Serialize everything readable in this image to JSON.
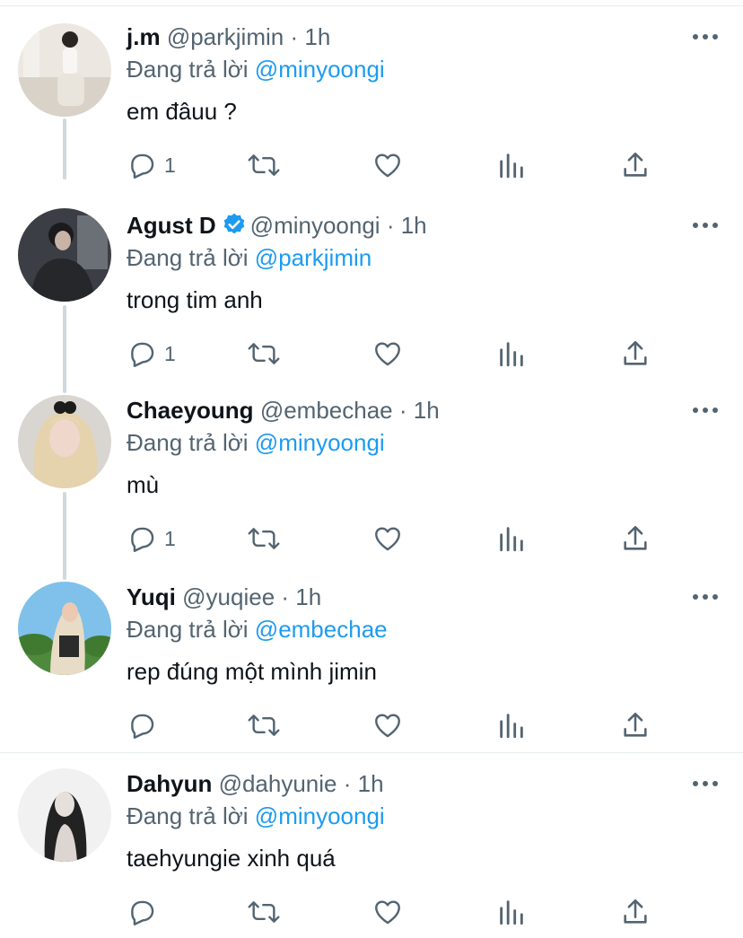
{
  "colors": {
    "accent": "#1d9bf0",
    "muted": "#536471",
    "text": "#0f1419",
    "divider": "#e6ecf0",
    "thread_line": "#cfd9de"
  },
  "reply_prefix": "Đang trả lời",
  "tweets": [
    {
      "name": "j.m",
      "handle": "@parkjimin",
      "time": "1h",
      "reply_to": "@minyoongi",
      "text": "em đâuu ?",
      "reply_count": "1",
      "verified": false
    },
    {
      "name": "Agust D",
      "handle": "@minyoongi",
      "time": "1h",
      "reply_to": "@parkjimin",
      "text": "trong tim anh",
      "reply_count": "1",
      "verified": true
    },
    {
      "name": "Chaeyoung",
      "handle": "@embechae",
      "time": "1h",
      "reply_to": "@minyoongi",
      "text": "mù",
      "reply_count": "1",
      "verified": false
    },
    {
      "name": "Yuqi",
      "handle": "@yuqiee",
      "time": "1h",
      "reply_to": "@embechae",
      "text": "rep đúng một mình jimin",
      "reply_count": "",
      "verified": false
    },
    {
      "name": "Dahyun",
      "handle": "@dahyunie",
      "time": "1h",
      "reply_to": "@minyoongi",
      "text": "taehyungie xinh quá",
      "reply_count": "",
      "verified": false
    }
  ],
  "icons": [
    "reply-icon",
    "retweet-icon",
    "like-icon",
    "analytics-icon",
    "share-icon",
    "more-icon",
    "verified-badge-icon"
  ]
}
